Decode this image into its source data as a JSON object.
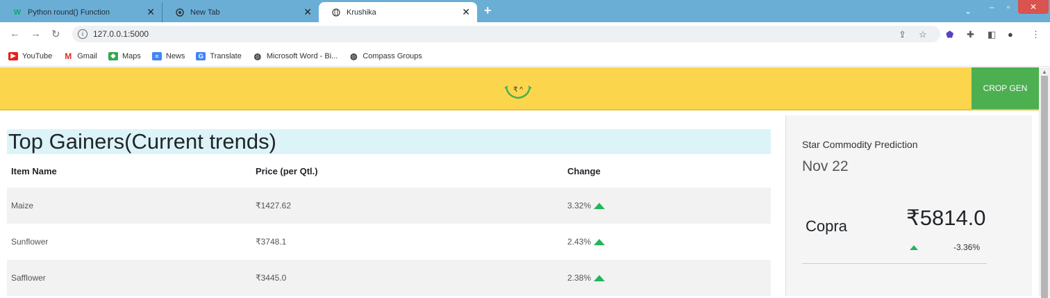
{
  "browser": {
    "tabs": [
      {
        "label": "Python round() Function",
        "icon": "w3schools-icon"
      },
      {
        "label": "New Tab",
        "icon": "chrome-icon"
      },
      {
        "label": "Krushika",
        "icon": "globe-icon"
      }
    ],
    "url": "127.0.0.1:5000",
    "bookmarks": [
      {
        "label": "YouTube",
        "color": "#e62117"
      },
      {
        "label": "Gmail",
        "color": "#d93025"
      },
      {
        "label": "Maps",
        "color": "#34a853"
      },
      {
        "label": "News",
        "color": "#4285f4"
      },
      {
        "label": "Translate",
        "color": "#4285f4"
      },
      {
        "label": "Microsoft Word - Bi...",
        "color": "#333333"
      },
      {
        "label": "Compass Groups",
        "color": "#333333"
      }
    ]
  },
  "header": {
    "cta_label": "CROP GEN",
    "bg_color": "#fbd54c",
    "cta_color": "#4caf50"
  },
  "main": {
    "title": "Top Gainers(Current trends)",
    "columns": [
      "Item Name",
      "Price (per Qtl.)",
      "Change"
    ],
    "rows": [
      {
        "name": "Maize",
        "price": "₹1427.62",
        "change": "3.32%"
      },
      {
        "name": "Sunflower",
        "price": "₹3748.1",
        "change": "2.43%"
      },
      {
        "name": "Safflower",
        "price": "₹3445.0",
        "change": "2.38%"
      }
    ]
  },
  "side": {
    "title": "Star Commodity Prediction",
    "date": "Nov 22",
    "commodity": {
      "name": "Copra",
      "price": "₹5814.0",
      "change": "-3.36%"
    }
  }
}
